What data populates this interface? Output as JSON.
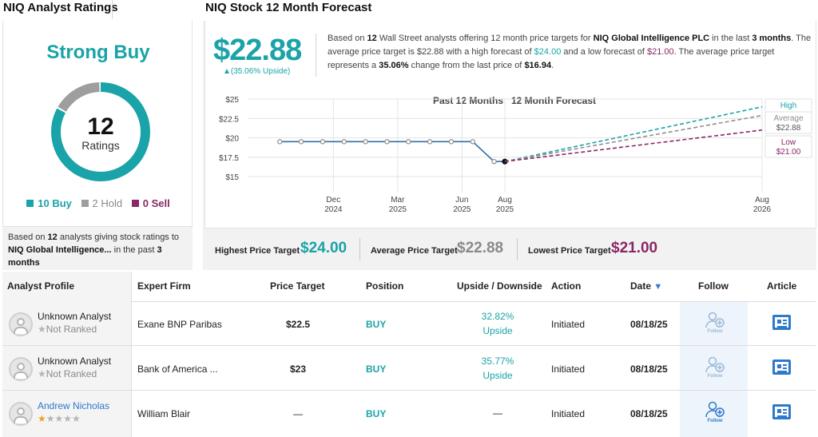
{
  "ratings": {
    "title": "NIQ Analyst Ratings",
    "consensus": "Strong Buy",
    "total": "12",
    "total_label": "Ratings",
    "buy_count": 10,
    "hold_count": 2,
    "sell_count": 0,
    "legend": {
      "buy": "10 Buy",
      "hold": "2 Hold",
      "sell": "0 Sell"
    },
    "note": {
      "p1": "Based on ",
      "count": "12",
      "p2": " analysts giving stock ratings to ",
      "company": "NIQ Global Intelligence...",
      "p3": " in the past ",
      "period": "3 months"
    },
    "colors": {
      "buy": "#1aa3a8",
      "hold": "#9e9e9e",
      "sell": "#8a2766",
      "accent": "#f08a1c"
    }
  },
  "forecast": {
    "title": "NIQ Stock 12 Month Forecast",
    "price": "$22.88",
    "upside": "▲(35.06% Upside)",
    "text": {
      "p1": "Based on ",
      "analysts": "12",
      "p2": " Wall Street analysts offering 12 month price targets for ",
      "company": "NIQ Global Intelligence PLC",
      "p3": " in the last ",
      "period": "3 months",
      "p4": ". The average price target is ",
      "avg": "$22.88",
      "p5": " with a high forecast of ",
      "high": "$24.00",
      "p6": " and a low forecast of ",
      "low": "$21.00",
      "p7": ". The average price target represents a ",
      "change": "35.06%",
      "p8": " change from the last price of ",
      "last": "$16.94",
      "p9": "."
    },
    "targets": {
      "highest_label": "Highest Price Target",
      "highest": "$24.00",
      "average_label": "Average Price Target",
      "average": "$22.88",
      "lowest_label": "Lowest Price Target",
      "lowest": "$21.00"
    }
  },
  "chart_data": {
    "type": "line",
    "title": "",
    "section_labels": [
      "Past 12 Months",
      "12 Month Forecast"
    ],
    "ylim": [
      15,
      25
    ],
    "y_ticks": [
      "$25",
      "$22.5",
      "$20",
      "$17.5",
      "$15"
    ],
    "y_tick_values": [
      25,
      22.5,
      20,
      17.5,
      15
    ],
    "x_ticks": [
      {
        "label": [
          "Dec",
          "2024"
        ],
        "m": 4
      },
      {
        "label": [
          "Mar",
          "2025"
        ],
        "m": 7
      },
      {
        "label": [
          "Jun",
          "2025"
        ],
        "m": 10
      },
      {
        "label": [
          "Aug",
          "2025"
        ],
        "m": 12
      },
      {
        "label": [
          "Aug",
          "2026"
        ],
        "m": 24
      }
    ],
    "x_start_m": 1.5,
    "x_end_m": 24,
    "history": [
      {
        "m": 1.5,
        "v": 19.5
      },
      {
        "m": 2.5,
        "v": 19.5
      },
      {
        "m": 3.5,
        "v": 19.5
      },
      {
        "m": 4.5,
        "v": 19.5
      },
      {
        "m": 5.5,
        "v": 19.5
      },
      {
        "m": 6.5,
        "v": 19.5
      },
      {
        "m": 7.5,
        "v": 19.5
      },
      {
        "m": 8.5,
        "v": 19.5
      },
      {
        "m": 9.5,
        "v": 19.5
      },
      {
        "m": 10.5,
        "v": 19.5
      },
      {
        "m": 11.5,
        "v": 16.94
      },
      {
        "m": 12,
        "v": 16.94
      }
    ],
    "forecast_start": {
      "m": 12,
      "v": 16.94
    },
    "series": [
      {
        "name": "High",
        "value": 24.0,
        "display": "$24.00",
        "color": "#1aa3a8"
      },
      {
        "name": "Average",
        "value": 22.88,
        "display": "$22.88",
        "color": "#8f8f8f"
      },
      {
        "name": "Low",
        "value": 21.0,
        "display": "$21.00",
        "color": "#8a2766"
      }
    ],
    "history_color": "#2d6fa7",
    "grid": true
  },
  "table": {
    "headers": {
      "profile": "Analyst Profile",
      "firm": "Expert Firm",
      "target": "Price Target",
      "position": "Position",
      "upside": "Upside / Downside",
      "action": "Action",
      "date": "Date",
      "date_sort": "▼",
      "follow": "Follow",
      "article": "Article"
    },
    "follow_label": "Follow",
    "rows": [
      {
        "name": "Unknown Analyst",
        "rank_star": "★",
        "rank": "Not Ranked",
        "firm": "Exane BNP Paribas",
        "target": "$22.5",
        "position": "BUY",
        "upside_value": "32.82%",
        "upside_label": "Upside",
        "action": "Initiated",
        "date": "08/18/25"
      },
      {
        "name": "Unknown Analyst",
        "rank_star": "★",
        "rank": "Not Ranked",
        "firm": "Bank of America ...",
        "target": "$23",
        "position": "BUY",
        "upside_value": "35.77%",
        "upside_label": "Upside",
        "action": "Initiated",
        "date": "08/18/25"
      },
      {
        "name": "Andrew Nicholas",
        "stars_on": "★",
        "stars_off": "★★★★",
        "stars": 1,
        "firm": "William Blair",
        "target": "—",
        "position": "BUY",
        "upside_value": "—",
        "upside_label": "",
        "action": "Initiated",
        "date": "08/18/25"
      }
    ]
  }
}
